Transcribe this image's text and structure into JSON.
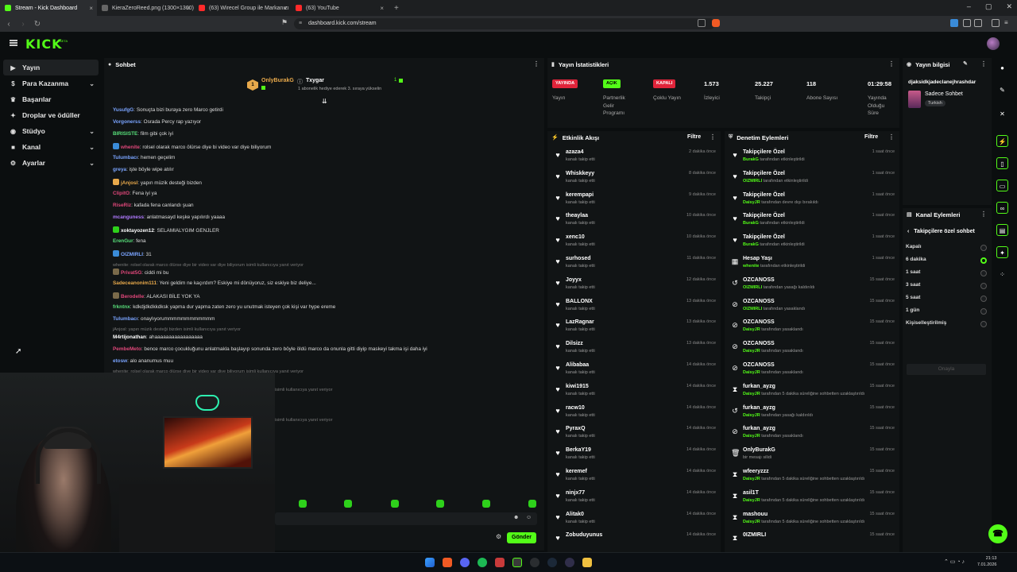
{
  "browser": {
    "tabs": [
      {
        "title": "Stream - Kick Dashboard",
        "color": "#53fc18",
        "active": true
      },
      {
        "title": "KieraZeroReed.png (1300×1300)",
        "color": "#666666"
      },
      {
        "title": "(63) Wirecel Group ile Markanızı Zirv",
        "color": "#ff2a2a"
      },
      {
        "title": "(63) YouTube",
        "color": "#ff2a2a"
      }
    ],
    "url": "dashboard.kick.com/stream"
  },
  "header": {
    "logo": "KICK",
    "logo_sup": "BETA"
  },
  "sidebar": {
    "items": [
      {
        "label": "Yayın",
        "icon": "broadcast-icon",
        "glyph": "▶",
        "active": true
      },
      {
        "label": "Para Kazanma",
        "icon": "money-icon",
        "glyph": "$",
        "chevron": true
      },
      {
        "label": "Başarılar",
        "icon": "trophy-icon",
        "glyph": "♛"
      },
      {
        "label": "Droplar ve ödüller",
        "icon": "gift-icon",
        "glyph": "✦"
      },
      {
        "label": "Stüdyo",
        "icon": "studio-icon",
        "glyph": "◉",
        "chevron": true
      },
      {
        "label": "Kanal",
        "icon": "channel-icon",
        "glyph": "■",
        "chevron": true
      },
      {
        "label": "Ayarlar",
        "icon": "settings-icon",
        "glyph": "⚙",
        "chevron": true
      }
    ]
  },
  "chat": {
    "title": "Sohbet",
    "pinned": {
      "rank": "1",
      "user1": "OnlyBurakG",
      "user2": "Txygar",
      "count": "1",
      "subtitle": "1 abonelik hediye ederek 3. sıraya yükselin"
    },
    "messages": [
      {
        "user": "YusufgG",
        "color": "#7aa4ff",
        "text": ": Sonuçta bizi buraya zero Marco getirdi"
      },
      {
        "user": "Vorgonerss",
        "color": "#7aa4ff",
        "text": ": Osrada Percy rap yazıyor"
      },
      {
        "user": "BIRISISTE",
        "color": "#58e07a",
        "text": ": film gibi çok iyi"
      },
      {
        "user": "whenite",
        "color": "#e0477a",
        "badge": "#3a8bd8",
        "text": ": rolsel olarak marco ölürse diye bi video var diye biliyorum"
      },
      {
        "user": "Tulumbacı",
        "color": "#7aa4ff",
        "text": ": hemen geçelim"
      },
      {
        "user": "greya",
        "color": "#7aa4ff",
        "text": ": işte böyle wipe atılır"
      },
      {
        "user": "jAnjosl",
        "color": "#e8a94b",
        "badge": "#e8a94b",
        "text": ": yapın müzik desteği bizden"
      },
      {
        "user": "ClipitO",
        "color": "#e0477a",
        "text": ": Fena iyi ya"
      },
      {
        "user": "RiseRiz",
        "color": "#e0477a",
        "text": ": kafada fena canlandı şuan"
      },
      {
        "user": "mcanguness",
        "color": "#b07aff",
        "text": ": anlatmasayd keşke yapılırdı yaaaa"
      },
      {
        "user": "xoktayozen12",
        "color": "#ffffff",
        "badge": "#2ed11b",
        "text": ": SELAMIALYGIM GENJLER"
      },
      {
        "user": "ErenGur",
        "color": "#58e07a",
        "text": ": fena"
      },
      {
        "user": "OIZMIRLI",
        "color": "#7aa4ff",
        "badge": "#3a8bd8",
        "text": ": 31"
      },
      {
        "system": true,
        "text": "whenite: rolsel olarak marco ölürse diye bir video var diye biliyorum isimli kullanıcıya yanıt veriyor"
      },
      {
        "user": "Privat5G",
        "color": "#e0477a",
        "badge": "#7a6a4a",
        "text": ": ciddi mi bu"
      },
      {
        "user": "Sadeceanonim111",
        "color": "#e8a94b",
        "text": ": Yeni geldim ne kaçırdım? Eskiye mi dönüyoruz, siz eskiye biz deliye..."
      },
      {
        "user": "Berodelle",
        "color": "#e0477a",
        "badge": "#7a6a4a",
        "text": ": ALAKASI BİLE YOK YA"
      },
      {
        "user": "frkntnx",
        "color": "#58e07a",
        "text": ": kdkdjdkdkkdksk yapma dur yapma zaten zero yu unutmak isteyen çok kişi var hype ereme"
      },
      {
        "user": "Tulumbacı",
        "color": "#7aa4ff",
        "text": ": onaylıyorummmmmmmmmmmm"
      },
      {
        "system": true,
        "text": "jAnjosl: yapın müzik desteği bizden isimli kullanıcıya yanıt veriyor"
      },
      {
        "user": "M4rtijonathan",
        "color": "#ffffff",
        "text": ": ahaaaaaaaaaaaaaaaaa"
      },
      {
        "user": "PembeMeto",
        "color": "#e0477a",
        "text": ": bence marco çocukluğunu anlatmakla başlayıp sonunda zero böyle öldü marco da onunla gitti diyip maskeyi takma işi daha iyi"
      },
      {
        "user": "etosw",
        "color": "#7aa4ff",
        "text": ": alo ananumus muu"
      },
      {
        "system": true,
        "text": "whenite: rolsel olarak marco ölürse diye bir video var diye biliyorum isimli kullanıcıya yanıt veriyor"
      },
      {
        "system": true,
        "text": "isimli kullanıcıya yanıt veriyor"
      },
      {
        "system": true,
        "text": "isimli kullanıcıya yanıt veriyor"
      }
    ],
    "send_label": "Gönder"
  },
  "stats": {
    "title": "Yayın İstatistikleri",
    "items": [
      {
        "pill": "YAYINDA",
        "pill_color": "#e0243a",
        "pill_text": "#ffffff",
        "label": "Yayın"
      },
      {
        "pill": "AÇIK",
        "pill_color": "#53fc18",
        "pill_text": "#000000",
        "label": "Partnerlik Gelir Programı"
      },
      {
        "pill": "KAPALI",
        "pill_color": "#e0243a",
        "pill_text": "#ffffff",
        "label": "Çoklu Yayın"
      },
      {
        "value": "1.573",
        "label": "İzleyici"
      },
      {
        "value": "25.227",
        "label": "Takipçi"
      },
      {
        "value": "118",
        "label": "Abone Sayısı"
      },
      {
        "value": "01:29:58",
        "label": "Yayında Olduğu Süre"
      }
    ]
  },
  "activity": {
    "title": "Etkinlik Akışı",
    "filter": "Filtre",
    "items": [
      {
        "name": "azaza4",
        "sub": "kanalı takip etti",
        "time": "2 dakika önce"
      },
      {
        "name": "Whiskkeyy",
        "sub": "kanalı takip etti",
        "time": "8 dakika önce"
      },
      {
        "name": "kerempapi",
        "sub": "kanalı takip etti",
        "time": "9 dakika önce"
      },
      {
        "name": "theaylaa",
        "sub": "kanalı takip etti",
        "time": "10 dakika önce"
      },
      {
        "name": "xenc10",
        "sub": "kanalı takip etti",
        "time": "10 dakika önce"
      },
      {
        "name": "surhosed",
        "sub": "kanalı takip etti",
        "time": "11 dakika önce"
      },
      {
        "name": "Joyyx",
        "sub": "kanalı takip etti",
        "time": "12 dakika önce"
      },
      {
        "name": "BALLONX",
        "sub": "kanalı takip etti",
        "time": "13 dakika önce"
      },
      {
        "name": "LazRagnar",
        "sub": "kanalı takip etti",
        "time": "13 dakika önce"
      },
      {
        "name": "Dilsizz",
        "sub": "kanalı takip etti",
        "time": "13 dakika önce"
      },
      {
        "name": "Alibabaa",
        "sub": "kanalı takip etti",
        "time": "14 dakika önce"
      },
      {
        "name": "kiwi1915",
        "sub": "kanalı takip etti",
        "time": "14 dakika önce"
      },
      {
        "name": "racw10",
        "sub": "kanalı takip etti",
        "time": "14 dakika önce"
      },
      {
        "name": "PyraxQ",
        "sub": "kanalı takip etti",
        "time": "14 dakika önce"
      },
      {
        "name": "BerkaY19",
        "sub": "kanalı takip etti",
        "time": "14 dakika önce"
      },
      {
        "name": "keremef",
        "sub": "kanalı takip etti",
        "time": "14 dakika önce"
      },
      {
        "name": "ninjx77",
        "sub": "kanalı takip etti",
        "time": "14 dakika önce"
      },
      {
        "name": "Alitak0",
        "sub": "kanalı takip etti",
        "time": "14 dakika önce"
      },
      {
        "name": "Zobuduyunus",
        "sub": "",
        "time": "14 dakika önce"
      }
    ]
  },
  "modlog": {
    "title": "Denetim Eylemleri",
    "filter": "Filtre",
    "items": [
      {
        "icon": "heart-icon",
        "glyph": "♥",
        "name": "Takipçilere Özel",
        "actor": "BurakG",
        "sub": " tarafından etkinleştirildi",
        "time": "1 saat önce"
      },
      {
        "icon": "heart-icon",
        "glyph": "♥",
        "name": "Takipçilere Özel",
        "actor": "OIZMIRLI",
        "sub": " tarafından etkinleştirildi",
        "time": "1 saat önce"
      },
      {
        "icon": "heart-icon",
        "glyph": "♥",
        "name": "Takipçilere Özel",
        "actor": "DaisyJR",
        "sub": " tarafından devre dışı bırakıldı",
        "time": "1 saat önce"
      },
      {
        "icon": "heart-icon",
        "glyph": "♥",
        "name": "Takipçilere Özel",
        "actor": "BurakG",
        "sub": " tarafından etkinleştirildi",
        "time": "1 saat önce"
      },
      {
        "icon": "heart-icon",
        "glyph": "♥",
        "name": "Takipçilere Özel",
        "actor": "BurakG",
        "sub": " tarafından etkinleştirildi",
        "time": "1 saat önce"
      },
      {
        "icon": "calendar-icon",
        "glyph": "▦",
        "name": "Hesap Yaşı",
        "actor": "whenite",
        "sub": " tarafından etkinleştirildi",
        "time": "1 saat önce"
      },
      {
        "icon": "undo-icon",
        "glyph": "↺",
        "name": "OZCANOSS",
        "actor": "OIZMIRLI",
        "sub": " tarafından yasağı kaldırıldı",
        "time": "15 saat önce"
      },
      {
        "icon": "ban-icon",
        "glyph": "⊘",
        "name": "OZCANOSS",
        "actor": "OIZMIRLI",
        "sub": " tarafından yasaklandı",
        "time": "15 saat önce"
      },
      {
        "icon": "ban-icon",
        "glyph": "⊘",
        "name": "OZCANOSS",
        "actor": "DaisyJR",
        "sub": " tarafından yasaklandı",
        "time": "15 saat önce"
      },
      {
        "icon": "ban-icon",
        "glyph": "⊘",
        "name": "OZCANOSS",
        "actor": "DaisyJR",
        "sub": " tarafından yasaklandı",
        "time": "15 saat önce"
      },
      {
        "icon": "ban-icon",
        "glyph": "⊘",
        "name": "OZCANOSS",
        "actor": "DaisyJR",
        "sub": " tarafından yasaklandı",
        "time": "15 saat önce"
      },
      {
        "icon": "hourglass-icon",
        "glyph": "⧗",
        "name": "furkan_ayzg",
        "actor": "DaisyJR",
        "sub": " tarafından 5 dakika süreliğine sohbetten uzaklaştırıldı",
        "time": "15 saat önce"
      },
      {
        "icon": "undo-icon",
        "glyph": "↺",
        "name": "furkan_ayzg",
        "actor": "DaisyJR",
        "sub": " tarafından yasağı kaldırıldı",
        "time": "15 saat önce"
      },
      {
        "icon": "ban-icon",
        "glyph": "⊘",
        "name": "furkan_ayzg",
        "actor": "DaisyJR",
        "sub": " tarafından yasaklandı",
        "time": "15 saat önce"
      },
      {
        "icon": "trash-icon",
        "glyph": "🗑",
        "name": "OnlyBurakG",
        "actor": "",
        "sub": "bir mesajı silidi",
        "time": "15 saat önce"
      },
      {
        "icon": "hourglass-icon",
        "glyph": "⧗",
        "name": "wfeeryzzz",
        "actor": "DaisyJR",
        "sub": " tarafından 5 dakika süreliğine sohbetten uzaklaştırıldı",
        "time": "15 saat önce"
      },
      {
        "icon": "hourglass-icon",
        "glyph": "⧗",
        "name": "asil1T",
        "actor": "DaisyJR",
        "sub": " tarafından 5 dakika süreliğine sohbetten uzaklaştırıldı",
        "time": "15 saat önce"
      },
      {
        "icon": "hourglass-icon",
        "glyph": "⧗",
        "name": "mashouu",
        "actor": "DaisyJR",
        "sub": " tarafından 5 dakika süreliğine sohbetten uzaklaştırıldı",
        "time": "15 saat önce"
      },
      {
        "icon": "hourglass-icon",
        "glyph": "⧗",
        "name": "0IZMIRLI",
        "actor": "",
        "sub": "",
        "time": "15 saat önce"
      }
    ]
  },
  "info": {
    "title": "Yayın bilgisi",
    "stream_title": "djaksidkjadeclanejhrashdar",
    "category": "Sadece Sohbet",
    "language": "Turkish"
  },
  "channel_actions": {
    "title": "Kanal Eylemleri",
    "back_label": "Takipçilere özel sohbet",
    "options": [
      {
        "label": "Kapalı",
        "selected": false
      },
      {
        "label": "6 dakika",
        "selected": true
      },
      {
        "label": "1 saat",
        "selected": false
      },
      {
        "label": "3 saat",
        "selected": false
      },
      {
        "label": "5 saat",
        "selected": false
      },
      {
        "label": "1 gün",
        "selected": false
      },
      {
        "label": "Kişiselleştirilmiş",
        "selected": false
      }
    ],
    "confirm_label": "Onayla"
  },
  "taskbar": {
    "clock_time": "21:13",
    "clock_date": "7.01.2026"
  },
  "colors": {
    "accent": "#53fc18",
    "live": "#e0243a",
    "panel": "#111415",
    "bg": "#0b0e0f"
  }
}
